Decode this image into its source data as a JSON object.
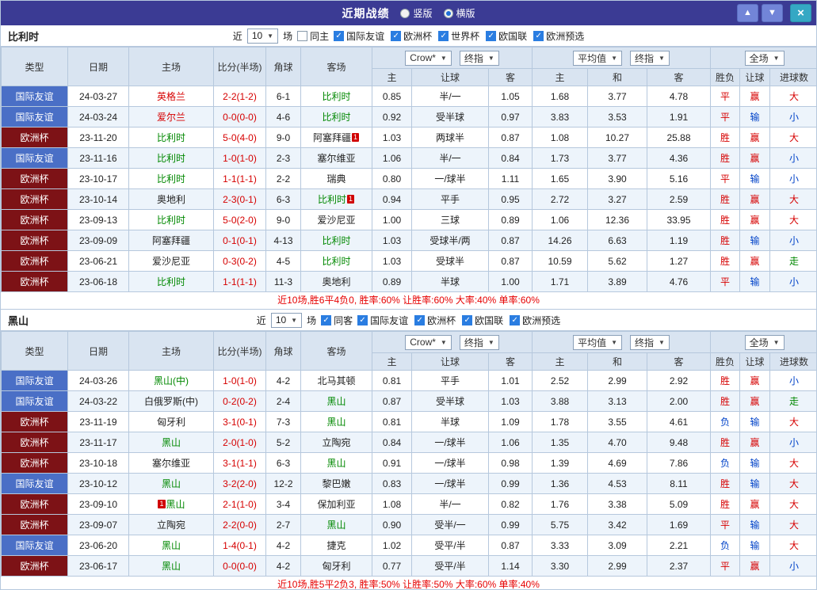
{
  "titlebar": {
    "title": "近期战绩",
    "layout_options": [
      {
        "label": "竖版",
        "selected": false
      },
      {
        "label": "横版",
        "selected": true
      }
    ],
    "icons": {
      "up": "▲",
      "down": "▼",
      "close": "×"
    }
  },
  "labels": {
    "near": "近",
    "games": "场"
  },
  "colors": {
    "topbar_bg": "#3b3b94",
    "header_bg": "#d9e4f1",
    "alt_row_bg": "#edf4fb",
    "grid_border": "#b6c8dd",
    "badge_friendly": "#4a6fc6",
    "badge_euro": "#7d1216",
    "team_green": "#008800",
    "win_red": "#d60000",
    "lose_blue": "#0042c8",
    "summary_red": "#e60000",
    "nav_blue": "#7285d8",
    "close_teal": "#35a8c4"
  },
  "table_header": {
    "type": "类型",
    "date": "日期",
    "home": "主场",
    "score": "比分(半场)",
    "corner": "角球",
    "away": "客场",
    "odds_source": "Crow*",
    "odds_stage": "终指",
    "avg_source": "平均值",
    "avg_stage": "终指",
    "scope": "全场",
    "sub": {
      "odds_home": "主",
      "odds_handicap": "让球",
      "odds_away": "客",
      "avg_home": "主",
      "avg_draw": "和",
      "avg_away": "客",
      "result": "胜负",
      "handicap_result": "让球",
      "goals_result": "进球数"
    }
  },
  "sections": [
    {
      "team": "比利时",
      "filter": {
        "count": "10",
        "same_label": "同主",
        "same_state": "unchecked",
        "comps": [
          {
            "label": "国际友谊",
            "state": "checked"
          },
          {
            "label": "欧洲杯",
            "state": "checked"
          },
          {
            "label": "世界杯",
            "state": "checked"
          },
          {
            "label": "欧国联",
            "state": "checked"
          },
          {
            "label": "欧洲预选",
            "state": "checked"
          }
        ]
      },
      "rows": [
        {
          "type": "国际友谊",
          "type_class": "friendly",
          "date": "24-03-27",
          "home": "英格兰",
          "home_color": "red",
          "score": "2-2(1-2)",
          "corner": "6-1",
          "away": "比利时",
          "away_color": "green",
          "odds_home": "0.85",
          "handicap": "半/一",
          "odds_away": "1.05",
          "avg_home": "1.68",
          "avg_draw": "3.77",
          "avg_away": "4.78",
          "result": "平",
          "result_color": "red",
          "handicap_result": "赢",
          "handicap_result_color": "red",
          "goals_result": "大",
          "goals_result_color": "red"
        },
        {
          "type": "国际友谊",
          "type_class": "friendly",
          "date": "24-03-24",
          "home": "爱尔兰",
          "home_color": "red",
          "score": "0-0(0-0)",
          "corner": "4-6",
          "away": "比利时",
          "away_color": "green",
          "odds_home": "0.92",
          "handicap": "受半球",
          "odds_away": "0.97",
          "avg_home": "3.83",
          "avg_draw": "3.53",
          "avg_away": "1.91",
          "result": "平",
          "result_color": "red",
          "handicap_result": "输",
          "handicap_result_color": "blue",
          "goals_result": "小",
          "goals_result_color": "blue"
        },
        {
          "type": "欧洲杯",
          "type_class": "euro",
          "date": "23-11-20",
          "home": "比利时",
          "home_color": "green",
          "score": "5-0(4-0)",
          "corner": "9-0",
          "away": "阿塞拜疆",
          "away_color": "black",
          "away_sup": "1",
          "odds_home": "1.03",
          "handicap": "两球半",
          "odds_away": "0.87",
          "avg_home": "1.08",
          "avg_draw": "10.27",
          "avg_away": "25.88",
          "result": "胜",
          "result_color": "red",
          "handicap_result": "赢",
          "handicap_result_color": "red",
          "goals_result": "大",
          "goals_result_color": "red"
        },
        {
          "type": "国际友谊",
          "type_class": "friendly",
          "date": "23-11-16",
          "home": "比利时",
          "home_color": "green",
          "score": "1-0(1-0)",
          "corner": "2-3",
          "away": "塞尔维亚",
          "away_color": "black",
          "odds_home": "1.06",
          "handicap": "半/一",
          "odds_away": "0.84",
          "avg_home": "1.73",
          "avg_draw": "3.77",
          "avg_away": "4.36",
          "result": "胜",
          "result_color": "red",
          "handicap_result": "赢",
          "handicap_result_color": "red",
          "goals_result": "小",
          "goals_result_color": "blue"
        },
        {
          "type": "欧洲杯",
          "type_class": "euro",
          "date": "23-10-17",
          "home": "比利时",
          "home_color": "green",
          "score": "1-1(1-1)",
          "corner": "2-2",
          "away": "瑞典",
          "away_color": "black",
          "odds_home": "0.80",
          "handicap": "一/球半",
          "odds_away": "1.11",
          "avg_home": "1.65",
          "avg_draw": "3.90",
          "avg_away": "5.16",
          "result": "平",
          "result_color": "red",
          "handicap_result": "输",
          "handicap_result_color": "blue",
          "goals_result": "小",
          "goals_result_color": "blue"
        },
        {
          "type": "欧洲杯",
          "type_class": "euro",
          "date": "23-10-14",
          "home": "奥地利",
          "home_color": "black",
          "score": "2-3(0-1)",
          "corner": "6-3",
          "away": "比利时",
          "away_color": "green",
          "away_sup": "1",
          "odds_home": "0.94",
          "handicap": "平手",
          "odds_away": "0.95",
          "avg_home": "2.72",
          "avg_draw": "3.27",
          "avg_away": "2.59",
          "result": "胜",
          "result_color": "red",
          "handicap_result": "赢",
          "handicap_result_color": "red",
          "goals_result": "大",
          "goals_result_color": "red"
        },
        {
          "type": "欧洲杯",
          "type_class": "euro",
          "date": "23-09-13",
          "home": "比利时",
          "home_color": "green",
          "score": "5-0(2-0)",
          "corner": "9-0",
          "away": "爱沙尼亚",
          "away_color": "black",
          "odds_home": "1.00",
          "handicap": "三球",
          "odds_away": "0.89",
          "avg_home": "1.06",
          "avg_draw": "12.36",
          "avg_away": "33.95",
          "result": "胜",
          "result_color": "red",
          "handicap_result": "赢",
          "handicap_result_color": "red",
          "goals_result": "大",
          "goals_result_color": "red"
        },
        {
          "type": "欧洲杯",
          "type_class": "euro",
          "date": "23-09-09",
          "home": "阿塞拜疆",
          "home_color": "black",
          "score": "0-1(0-1)",
          "corner": "4-13",
          "away": "比利时",
          "away_color": "green",
          "odds_home": "1.03",
          "handicap": "受球半/两",
          "odds_away": "0.87",
          "avg_home": "14.26",
          "avg_draw": "6.63",
          "avg_away": "1.19",
          "result": "胜",
          "result_color": "red",
          "handicap_result": "输",
          "handicap_result_color": "blue",
          "goals_result": "小",
          "goals_result_color": "blue"
        },
        {
          "type": "欧洲杯",
          "type_class": "euro",
          "date": "23-06-21",
          "home": "爱沙尼亚",
          "home_color": "black",
          "score": "0-3(0-2)",
          "corner": "4-5",
          "away": "比利时",
          "away_color": "green",
          "odds_home": "1.03",
          "handicap": "受球半",
          "odds_away": "0.87",
          "avg_home": "10.59",
          "avg_draw": "5.62",
          "avg_away": "1.27",
          "result": "胜",
          "result_color": "red",
          "handicap_result": "赢",
          "handicap_result_color": "red",
          "goals_result": "走",
          "goals_result_color": "green"
        },
        {
          "type": "欧洲杯",
          "type_class": "euro",
          "date": "23-06-18",
          "home": "比利时",
          "home_color": "green",
          "score": "1-1(1-1)",
          "corner": "11-3",
          "away": "奥地利",
          "away_color": "black",
          "odds_home": "0.89",
          "handicap": "半球",
          "odds_away": "1.00",
          "avg_home": "1.71",
          "avg_draw": "3.89",
          "avg_away": "4.76",
          "result": "平",
          "result_color": "red",
          "handicap_result": "输",
          "handicap_result_color": "blue",
          "goals_result": "小",
          "goals_result_color": "blue"
        }
      ],
      "summary": "近10场,胜6平4负0, 胜率:60% 让胜率:60% 大率:40% 单率:60%"
    },
    {
      "team": "黑山",
      "filter": {
        "count": "10",
        "same_label": "同客",
        "same_state": "checked",
        "comps": [
          {
            "label": "国际友谊",
            "state": "checked"
          },
          {
            "label": "欧洲杯",
            "state": "checked"
          },
          {
            "label": "欧国联",
            "state": "checked"
          },
          {
            "label": "欧洲预选",
            "state": "checked"
          }
        ]
      },
      "rows": [
        {
          "type": "国际友谊",
          "type_class": "friendly",
          "date": "24-03-26",
          "home": "黑山(中)",
          "home_color": "green",
          "score": "1-0(1-0)",
          "corner": "4-2",
          "away": "北马其顿",
          "away_color": "black",
          "odds_home": "0.81",
          "handicap": "平手",
          "odds_away": "1.01",
          "avg_home": "2.52",
          "avg_draw": "2.99",
          "avg_away": "2.92",
          "result": "胜",
          "result_color": "red",
          "handicap_result": "赢",
          "handicap_result_color": "red",
          "goals_result": "小",
          "goals_result_color": "blue"
        },
        {
          "type": "国际友谊",
          "type_class": "friendly",
          "date": "24-03-22",
          "home": "白俄罗斯(中)",
          "home_color": "black",
          "score": "0-2(0-2)",
          "corner": "2-4",
          "away": "黑山",
          "away_color": "green",
          "odds_home": "0.87",
          "handicap": "受半球",
          "odds_away": "1.03",
          "avg_home": "3.88",
          "avg_draw": "3.13",
          "avg_away": "2.00",
          "result": "胜",
          "result_color": "red",
          "handicap_result": "赢",
          "handicap_result_color": "red",
          "goals_result": "走",
          "goals_result_color": "green"
        },
        {
          "type": "欧洲杯",
          "type_class": "euro",
          "date": "23-11-19",
          "home": "匈牙利",
          "home_color": "black",
          "score": "3-1(0-1)",
          "corner": "7-3",
          "away": "黑山",
          "away_color": "green",
          "odds_home": "0.81",
          "handicap": "半球",
          "odds_away": "1.09",
          "avg_home": "1.78",
          "avg_draw": "3.55",
          "avg_away": "4.61",
          "result": "负",
          "result_color": "blue",
          "handicap_result": "输",
          "handicap_result_color": "blue",
          "goals_result": "大",
          "goals_result_color": "red"
        },
        {
          "type": "欧洲杯",
          "type_class": "euro",
          "date": "23-11-17",
          "home": "黑山",
          "home_color": "green",
          "score": "2-0(1-0)",
          "corner": "5-2",
          "away": "立陶宛",
          "away_color": "black",
          "odds_home": "0.84",
          "handicap": "一/球半",
          "odds_away": "1.06",
          "avg_home": "1.35",
          "avg_draw": "4.70",
          "avg_away": "9.48",
          "result": "胜",
          "result_color": "red",
          "handicap_result": "赢",
          "handicap_result_color": "red",
          "goals_result": "小",
          "goals_result_color": "blue"
        },
        {
          "type": "欧洲杯",
          "type_class": "euro",
          "date": "23-10-18",
          "home": "塞尔维亚",
          "home_color": "black",
          "score": "3-1(1-1)",
          "corner": "6-3",
          "away": "黑山",
          "away_color": "green",
          "odds_home": "0.91",
          "handicap": "一/球半",
          "odds_away": "0.98",
          "avg_home": "1.39",
          "avg_draw": "4.69",
          "avg_away": "7.86",
          "result": "负",
          "result_color": "blue",
          "handicap_result": "输",
          "handicap_result_color": "blue",
          "goals_result": "大",
          "goals_result_color": "red"
        },
        {
          "type": "国际友谊",
          "type_class": "friendly",
          "date": "23-10-12",
          "home": "黑山",
          "home_color": "green",
          "score": "3-2(2-0)",
          "corner": "12-2",
          "away": "黎巴嫩",
          "away_color": "black",
          "odds_home": "0.83",
          "handicap": "一/球半",
          "odds_away": "0.99",
          "avg_home": "1.36",
          "avg_draw": "4.53",
          "avg_away": "8.11",
          "result": "胜",
          "result_color": "red",
          "handicap_result": "输",
          "handicap_result_color": "blue",
          "goals_result": "大",
          "goals_result_color": "red"
        },
        {
          "type": "欧洲杯",
          "type_class": "euro",
          "date": "23-09-10",
          "home": "黑山",
          "home_color": "green",
          "home_sup_pre": "1",
          "score": "2-1(1-0)",
          "corner": "3-4",
          "away": "保加利亚",
          "away_color": "black",
          "odds_home": "1.08",
          "handicap": "半/一",
          "odds_away": "0.82",
          "avg_home": "1.76",
          "avg_draw": "3.38",
          "avg_away": "5.09",
          "result": "胜",
          "result_color": "red",
          "handicap_result": "赢",
          "handicap_result_color": "red",
          "goals_result": "大",
          "goals_result_color": "red"
        },
        {
          "type": "欧洲杯",
          "type_class": "euro",
          "date": "23-09-07",
          "home": "立陶宛",
          "home_color": "black",
          "score": "2-2(0-0)",
          "corner": "2-7",
          "away": "黑山",
          "away_color": "green",
          "odds_home": "0.90",
          "handicap": "受半/一",
          "odds_away": "0.99",
          "avg_home": "5.75",
          "avg_draw": "3.42",
          "avg_away": "1.69",
          "result": "平",
          "result_color": "red",
          "handicap_result": "输",
          "handicap_result_color": "blue",
          "goals_result": "大",
          "goals_result_color": "red"
        },
        {
          "type": "国际友谊",
          "type_class": "friendly",
          "date": "23-06-20",
          "home": "黑山",
          "home_color": "green",
          "score": "1-4(0-1)",
          "corner": "4-2",
          "away": "捷克",
          "away_color": "black",
          "odds_home": "1.02",
          "handicap": "受平/半",
          "odds_away": "0.87",
          "avg_home": "3.33",
          "avg_draw": "3.09",
          "avg_away": "2.21",
          "result": "负",
          "result_color": "blue",
          "handicap_result": "输",
          "handicap_result_color": "blue",
          "goals_result": "大",
          "goals_result_color": "red"
        },
        {
          "type": "欧洲杯",
          "type_class": "euro",
          "date": "23-06-17",
          "home": "黑山",
          "home_color": "green",
          "score": "0-0(0-0)",
          "corner": "4-2",
          "away": "匈牙利",
          "away_color": "black",
          "odds_home": "0.77",
          "handicap": "受平/半",
          "odds_away": "1.14",
          "avg_home": "3.30",
          "avg_draw": "2.99",
          "avg_away": "2.37",
          "result": "平",
          "result_color": "red",
          "handicap_result": "赢",
          "handicap_result_color": "red",
          "goals_result": "小",
          "goals_result_color": "blue"
        }
      ],
      "summary": "近10场,胜5平2负3, 胜率:50% 让胜率:50% 大率:60% 单率:40%"
    }
  ]
}
